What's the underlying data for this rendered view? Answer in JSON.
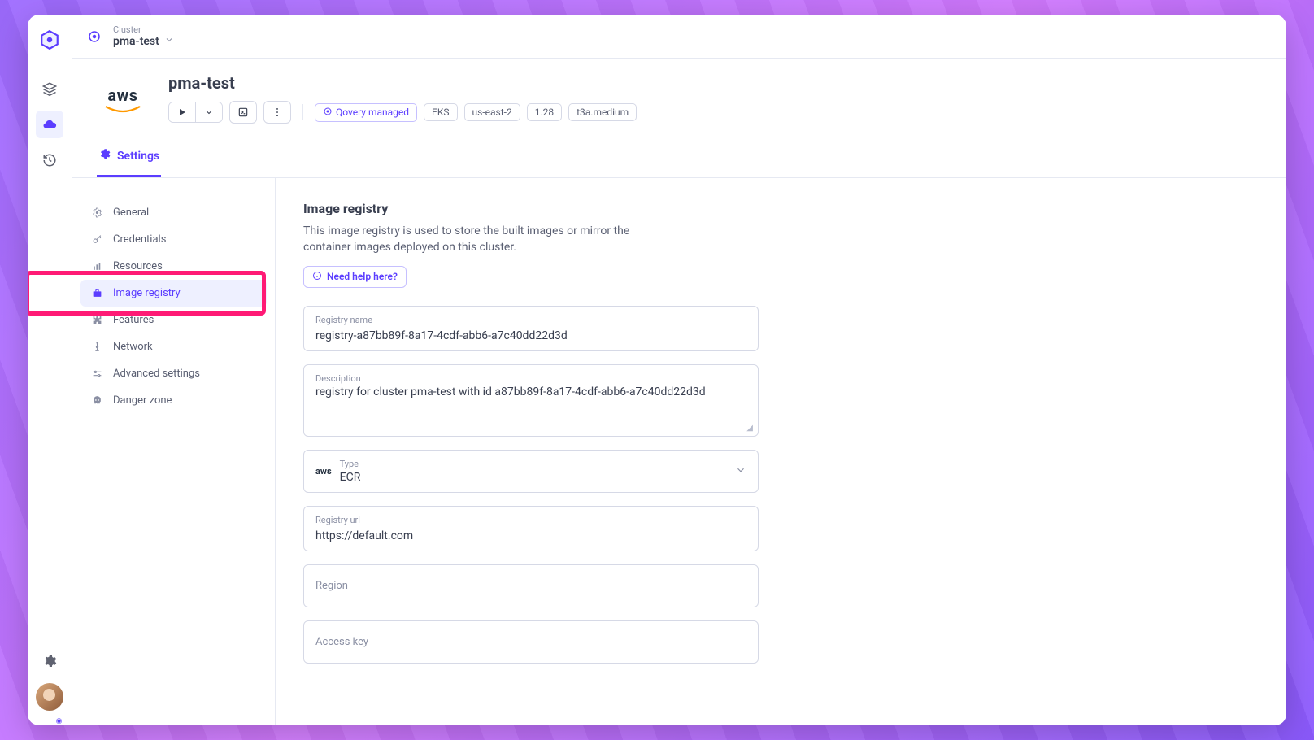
{
  "breadcrumb": {
    "label": "Cluster",
    "value": "pma-test"
  },
  "cluster": {
    "name": "pma-test",
    "provider": "aws",
    "tags": {
      "managed": "Qovery managed",
      "engine": "EKS",
      "region": "us-east-2",
      "version": "1.28",
      "instance": "t3a.medium"
    }
  },
  "tab": {
    "settings": "Settings"
  },
  "settings_nav": {
    "general": "General",
    "credentials": "Credentials",
    "resources": "Resources",
    "image_registry": "Image registry",
    "features": "Features",
    "network": "Network",
    "advanced": "Advanced settings",
    "danger": "Danger zone"
  },
  "panel": {
    "title": "Image registry",
    "description": "This image registry is used to store the built images or mirror the container images deployed on this cluster.",
    "help": "Need help here?"
  },
  "form": {
    "registry_name": {
      "label": "Registry name",
      "value": "registry-a87bb89f-8a17-4cdf-abb6-a7c40dd22d3d"
    },
    "description": {
      "label": "Description",
      "value": "registry for cluster pma-test with id a87bb89f-8a17-4cdf-abb6-a7c40dd22d3d"
    },
    "type": {
      "label": "Type",
      "value": "ECR"
    },
    "registry_url": {
      "label": "Registry url",
      "value": "https://default.com"
    },
    "region": {
      "label": "Region",
      "value": ""
    },
    "access_key": {
      "label": "Access key",
      "value": ""
    }
  }
}
